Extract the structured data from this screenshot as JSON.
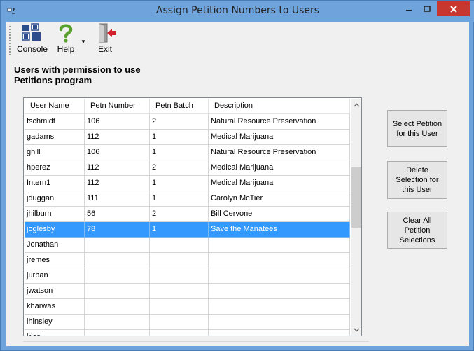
{
  "window": {
    "title": "Assign Petition Numbers to Users"
  },
  "toolbar": {
    "console_label": "Console",
    "help_label": "Help",
    "exit_label": "Exit"
  },
  "heading": {
    "line1": "Users with permission to use",
    "line2": "Petitions program"
  },
  "grid": {
    "columns": [
      "User Name",
      "Petn Number",
      "Petn Batch",
      "Description"
    ],
    "rows": [
      [
        "fschmidt",
        "106",
        "2",
        "Natural Resource Preservation"
      ],
      [
        "gadams",
        "112",
        "1",
        "Medical Marijuana"
      ],
      [
        "ghill",
        "106",
        "1",
        "Natural Resource Preservation"
      ],
      [
        "hperez",
        "112",
        "2",
        "Medical Marijuana"
      ],
      [
        "Intern1",
        "112",
        "1",
        "Medical Marijuana"
      ],
      [
        "jduggan",
        "111",
        "1",
        "Carolyn McTier"
      ],
      [
        "jhilburn",
        "56",
        "2",
        "Bill Cervone"
      ],
      [
        "joglesby",
        "78",
        "1",
        "Save the Manatees"
      ],
      [
        "Jonathan",
        "",
        "",
        ""
      ],
      [
        "jremes",
        "",
        "",
        ""
      ],
      [
        "jurban",
        "",
        "",
        ""
      ],
      [
        "jwatson",
        "",
        "",
        ""
      ],
      [
        "kharwas",
        "",
        "",
        ""
      ],
      [
        "lhinsley",
        "",
        "",
        ""
      ],
      [
        "lrice",
        "",
        "",
        ""
      ]
    ],
    "selected_row": 7
  },
  "buttons": {
    "select_petition": "Select Petition for this User",
    "delete_selection": "Delete Selection for this User",
    "clear_all": "Clear All Petition Selections"
  },
  "colors": {
    "selection": "#3399ff",
    "titlebar": "#6fa3dc",
    "close": "#c7372f"
  }
}
